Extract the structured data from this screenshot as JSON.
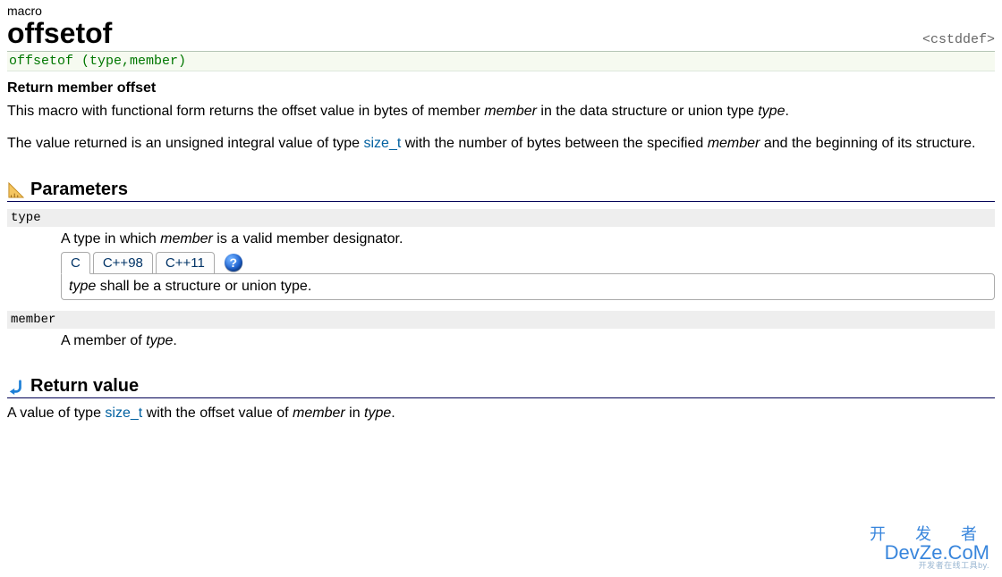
{
  "header": {
    "kind": "macro",
    "title": "offsetof",
    "include": "<cstddef>"
  },
  "syntax": "offsetof (type,member)",
  "subtitle": "Return member offset",
  "desc1_pre": "This macro with functional form returns the offset value in bytes of member ",
  "desc1_mid": "member",
  "desc1_after": " in the data structure or union type ",
  "desc1_tail": "type",
  "desc1_end": ".",
  "desc2_pre": "The value returned is an unsigned integral value of type ",
  "desc2_link": "size_t",
  "desc2_after": " with the number of bytes between the specified ",
  "desc2_ital": "member",
  "desc2_end": " and the beginning of its structure.",
  "sections": {
    "parameters": "Parameters",
    "return": "Return value"
  },
  "params": {
    "type": {
      "name": "type",
      "desc_pre": "A type in which ",
      "desc_ital": "member",
      "desc_post": " is a valid member designator.",
      "tabs": [
        "C",
        "C++98",
        "C++11"
      ],
      "tab_body_ital": "type",
      "tab_body_rest": " shall be a structure or union type."
    },
    "member": {
      "name": "member",
      "desc_pre": "A member of ",
      "desc_ital": "type",
      "desc_post": "."
    }
  },
  "return_pre": "A value of type ",
  "return_link": "size_t",
  "return_mid": " with the offset value of ",
  "return_ital1": "member",
  "return_in": " in ",
  "return_ital2": "type",
  "return_end": ".",
  "watermark": {
    "cn": "开 发 者",
    "en": "DevZe.CoM",
    "sm": "开发者在线工具by."
  },
  "icons": {
    "help": "?"
  }
}
